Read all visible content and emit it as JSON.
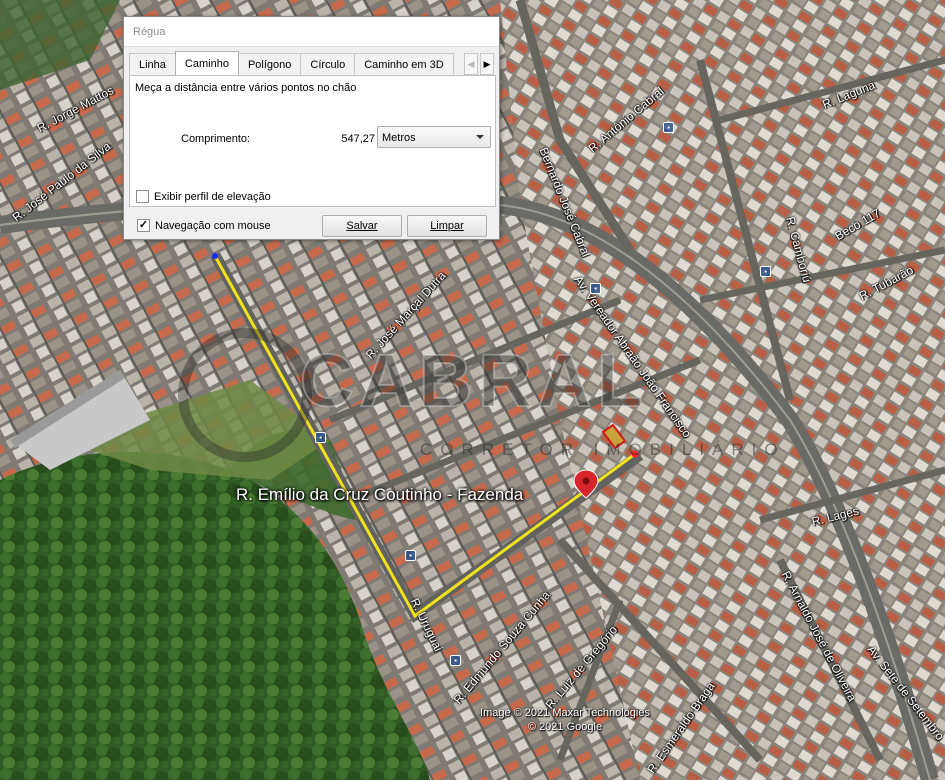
{
  "dialog": {
    "title": "Régua",
    "tabs": [
      "Linha",
      "Caminho",
      "Polígono",
      "Círculo",
      "Caminho em 3D"
    ],
    "active_tab": "Caminho",
    "description": "Meça a distância entre vários pontos no chão",
    "length_label": "Comprimento:",
    "length_value": "547,27",
    "unit": "Metros",
    "elevation_profile_label": "Exibir perfil de elevação",
    "elevation_profile_checked": false,
    "mouse_navigation_label": "Navegação com mouse",
    "mouse_navigation_checked": true,
    "save_button": "Salvar",
    "clear_button": "Limpar"
  },
  "map": {
    "place_label": "R. Emílio da Cruz Coutinho - Fazenda",
    "watermark": "CABRAL",
    "watermark_sub": "CORRETOR IMOBILIÁRIO",
    "copyright_line1": "Image © 2021 Maxar Technologies",
    "copyright_line2": "© 2021 Google",
    "path_color": "#f2e21a",
    "streets": [
      "R. Jorge Mattos",
      "R. José Paulo da Silva",
      "R. Antônio Cabral",
      "R. Laguna",
      "Av. Vereador Abraão João Francisco",
      "Bernardo José Cabral",
      "R. José Marçal Dutra",
      "R. Camboriú",
      "Beco 117",
      "R. Tubarão",
      "R. Lages",
      "R. Uruguai",
      "R. Edmundo Souza Cunha",
      "R. Luiz de Gregório",
      "R. Esmeraldo Braga",
      "R. Arnaldo José de Oliveira",
      "Av. Sete de Setembro"
    ]
  }
}
